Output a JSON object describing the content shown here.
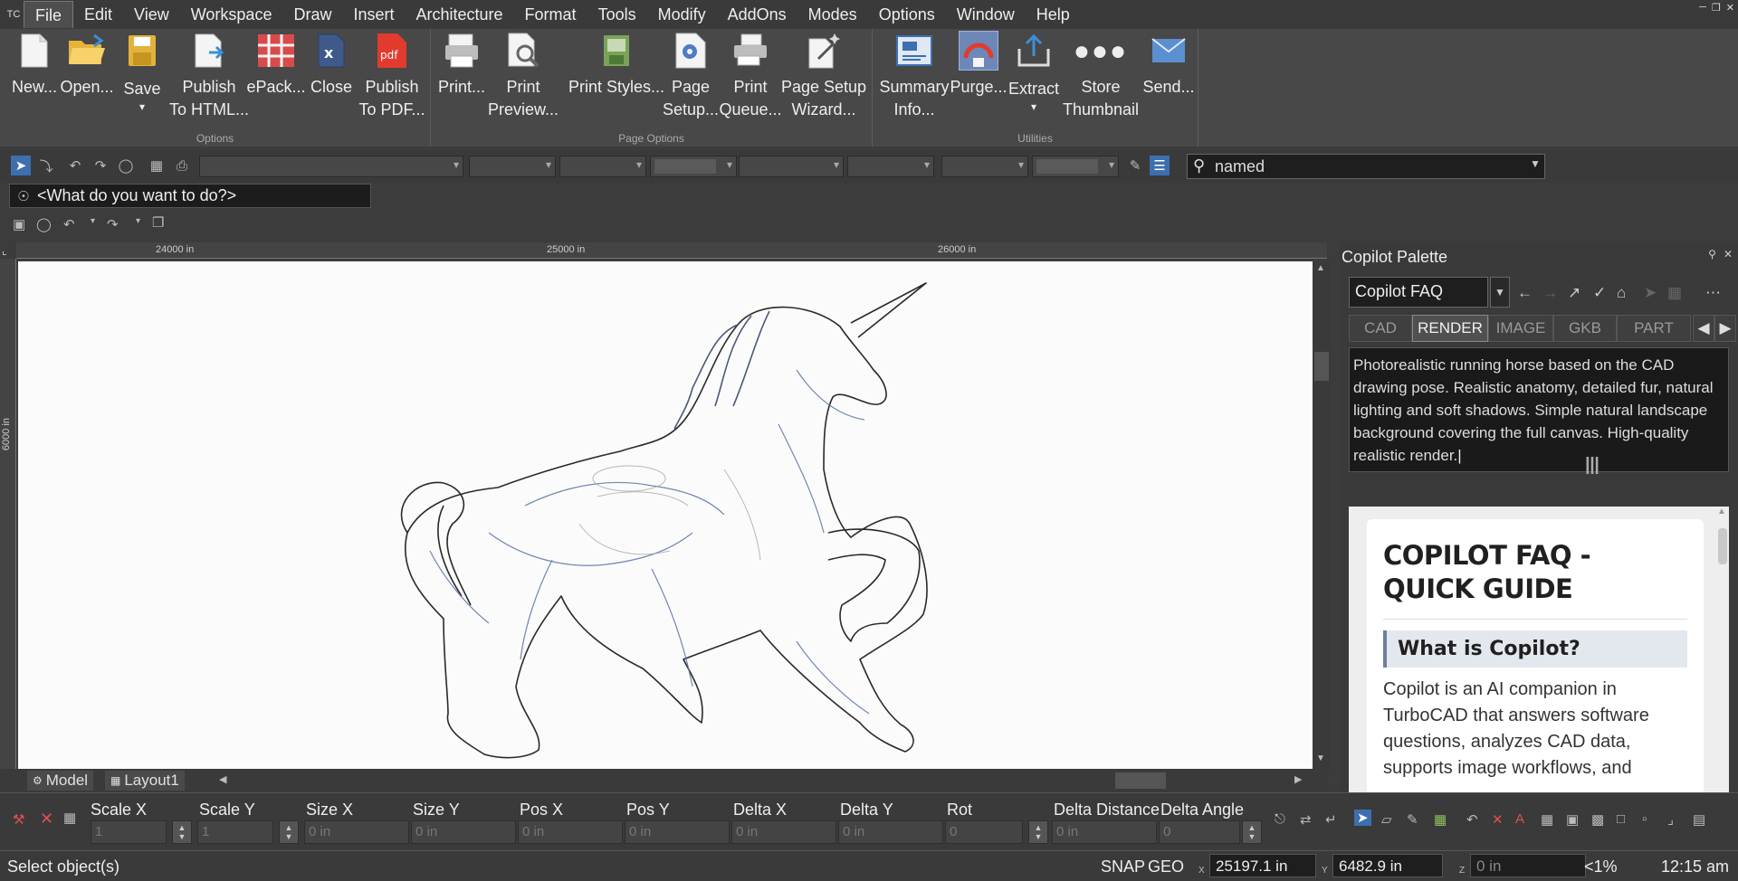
{
  "menu": {
    "app_icon": "TC",
    "items": [
      "File",
      "Edit",
      "View",
      "Workspace",
      "Draw",
      "Insert",
      "Architecture",
      "Format",
      "Tools",
      "Modify",
      "AddOns",
      "Modes",
      "Options",
      "Window",
      "Help"
    ]
  },
  "ribbon": {
    "buttons": [
      {
        "l1": "New...",
        "l2": "",
        "icon": "new-document-icon"
      },
      {
        "l1": "Open...",
        "l2": "",
        "icon": "open-folder-icon"
      },
      {
        "l1": "Save",
        "l2": "▾",
        "icon": "save-icon"
      },
      {
        "l1": "Publish",
        "l2": "To HTML...",
        "icon": "publish-html-icon"
      },
      {
        "l1": "ePack...",
        "l2": "",
        "icon": "epack-icon"
      },
      {
        "l1": "Close",
        "l2": "",
        "icon": "close-document-icon"
      },
      {
        "l1": "Publish",
        "l2": "To PDF...",
        "icon": "pdf-icon"
      },
      {
        "l1": "Print...",
        "l2": "",
        "icon": "printer-icon"
      },
      {
        "l1": "Print",
        "l2": "Preview...",
        "icon": "print-preview-icon"
      },
      {
        "l1": "Print Styles...",
        "l2": "",
        "icon": "print-styles-icon"
      },
      {
        "l1": "Page",
        "l2": "Setup...",
        "icon": "page-setup-icon"
      },
      {
        "l1": "Print",
        "l2": "Queue...",
        "icon": "print-queue-icon"
      },
      {
        "l1": "Page Setup",
        "l2": "Wizard...",
        "icon": "wizard-icon"
      },
      {
        "l1": "Summary",
        "l2": "Info...",
        "icon": "summary-info-icon"
      },
      {
        "l1": "Purge...",
        "l2": "",
        "icon": "purge-icon"
      },
      {
        "l1": "Extract",
        "l2": "▾",
        "icon": "extract-icon"
      },
      {
        "l1": "Store",
        "l2": "Thumbnail",
        "icon": "more-dots-icon"
      },
      {
        "l1": "Send...",
        "l2": "",
        "icon": "send-mail-icon"
      }
    ],
    "groups": [
      "Options",
      "Page Options",
      "Utilities"
    ]
  },
  "search": {
    "value": "named",
    "icon": "search-icon"
  },
  "what_box": {
    "text": "<What do you want to do?>"
  },
  "ruler": {
    "labels": [
      "24000 in",
      "25000 in",
      "26000 in"
    ],
    "vlabel": "6000 in"
  },
  "layout_tabs": [
    "Model",
    "Layout1"
  ],
  "palette": {
    "title": "Copilot Palette",
    "combo": "Copilot FAQ",
    "tabs": [
      "CAD",
      "RENDER",
      "IMAGE",
      "GKB",
      "PART"
    ],
    "active_tab": "RENDER",
    "prompt": "Photorealistic running horse based on the CAD drawing pose. Realistic anatomy, detailed fur, natural lighting and soft shadows. Simple natural landscape background covering the full canvas. High-quality realistic render.",
    "faq": {
      "title": "COPILOT FAQ - QUICK GUIDE",
      "question": "What is Copilot?",
      "answer": "Copilot is an AI companion in TurboCAD that answers software questions, analyzes CAD data, supports image workflows, and"
    }
  },
  "fields": [
    {
      "label": "Scale X",
      "value": "1",
      "spin": true
    },
    {
      "label": "Scale Y",
      "value": "1",
      "spin": true
    },
    {
      "label": "Size X",
      "value": "0 in",
      "spin": false
    },
    {
      "label": "Size Y",
      "value": "0 in",
      "spin": false
    },
    {
      "label": "Pos X",
      "value": "0 in",
      "spin": false
    },
    {
      "label": "Pos Y",
      "value": "0 in",
      "spin": false
    },
    {
      "label": "Delta X",
      "value": "0 in",
      "spin": false
    },
    {
      "label": "Delta Y",
      "value": "0 in",
      "spin": false
    },
    {
      "label": "Rot",
      "value": "0",
      "spin": true
    },
    {
      "label": "Delta Distance",
      "value": "0 in",
      "spin": false
    },
    {
      "label": "Delta Angle",
      "value": "0",
      "spin": true
    }
  ],
  "status": {
    "message": "Select object(s)",
    "snap": "SNAP",
    "geo": "GEO",
    "x_label": "X",
    "x": "25197.1 in",
    "y_label": "Y",
    "y": "6482.9 in",
    "z_label": "Z",
    "z": "0 in",
    "zoom": "<1%",
    "time": "12:15 am"
  },
  "colors": {
    "accent": "#3d6fb0",
    "canvas": "#fbfbfb",
    "drawing_line": "#2d3a52"
  }
}
